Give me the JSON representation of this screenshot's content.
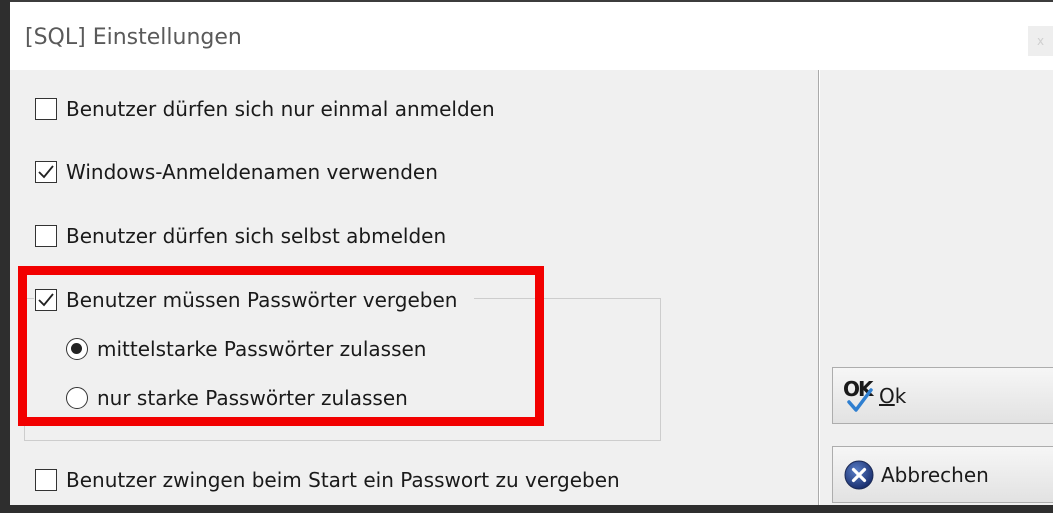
{
  "window": {
    "title": "[SQL] Einstellungen",
    "close_label": "x"
  },
  "options": {
    "single_login": {
      "label": "Benutzer dürfen sich nur einmal anmelden",
      "checked": false
    },
    "windows_names": {
      "label": "Windows-Anmeldenamen verwenden",
      "checked": true
    },
    "self_logout": {
      "label": "Benutzer dürfen sich selbst abmelden",
      "checked": false
    },
    "require_passwords": {
      "label": "Benutzer müssen Passwörter vergeben",
      "checked": true
    },
    "force_password": {
      "label": "Benutzer zwingen beim Start ein Passwort zu vergeben",
      "checked": false
    }
  },
  "password_strength": {
    "medium": {
      "label": "mittelstarke Passwörter zulassen",
      "selected": true
    },
    "strong": {
      "label": "nur starke Passwörter zulassen",
      "selected": false
    }
  },
  "buttons": {
    "ok_icon_text": "OK",
    "ok_prefix": "O",
    "ok_rest": "k",
    "cancel": "Abbrechen"
  },
  "colors": {
    "highlight": "#f20000",
    "dialog_bg": "#f0f0f0"
  }
}
